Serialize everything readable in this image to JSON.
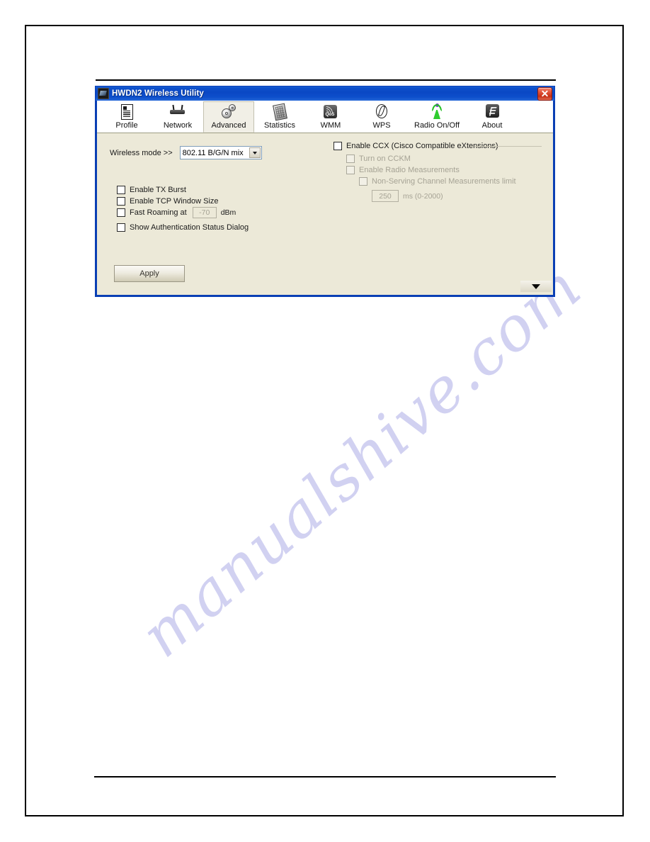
{
  "watermark": {
    "text": "manualshive.com"
  },
  "window": {
    "title": "HWDN2 Wireless Utility",
    "app_icon": "wireless-adapter-icon",
    "close_label": "Close",
    "expand_label": "expand-down-arrow"
  },
  "tabs": [
    {
      "label": "Profile",
      "icon": "profile-document-icon",
      "selected": false
    },
    {
      "label": "Network",
      "icon": "router-icon",
      "selected": false
    },
    {
      "label": "Advanced",
      "icon": "gears-icon",
      "selected": true
    },
    {
      "label": "Statistics",
      "icon": "statistics-grid-icon",
      "selected": false
    },
    {
      "label": "WMM",
      "icon": "qos-signal-icon",
      "selected": false
    },
    {
      "label": "WPS",
      "icon": "wps-circle-icon",
      "selected": false
    },
    {
      "label": "Radio On/Off",
      "icon": "radio-antenna-icon",
      "selected": false
    },
    {
      "label": "About",
      "icon": "about-icon",
      "selected": false
    }
  ],
  "advanced": {
    "wireless_mode_label": "Wireless mode >>",
    "wireless_mode_value": "802.11 B/G/N mix",
    "wireless_mode_options": [
      "802.11 B/G/N mix"
    ],
    "options": [
      {
        "label": "Enable TX Burst",
        "checked": false,
        "enabled": true
      },
      {
        "label": "Enable TCP Window Size",
        "checked": false,
        "enabled": true
      },
      {
        "label": "Fast Roaming at",
        "checked": false,
        "enabled": true
      },
      {
        "label": "Show Authentication Status Dialog",
        "checked": false,
        "enabled": true
      }
    ],
    "fast_roaming_value": "-70",
    "fast_roaming_unit": "dBm",
    "apply_label": "Apply"
  },
  "ccx": {
    "title": "Enable CCX (Cisco Compatible eXtensions)",
    "checked": false,
    "items": [
      {
        "label": "Turn on CCKM",
        "checked": false,
        "enabled": false
      },
      {
        "label": "Enable Radio Measurements",
        "checked": false,
        "enabled": false
      },
      {
        "label": "Non-Serving Channel Measurements limit",
        "checked": false,
        "enabled": false
      }
    ],
    "limit_value": "250",
    "limit_unit": "ms (0-2000)"
  },
  "colors": {
    "titlebar_blue": "#0a47c4",
    "window_border": "#0a3fb4",
    "client_bg": "#ece9d8",
    "close_red": "#c62f16",
    "radio_green": "#2ecc2e",
    "watermark": "#c9c9ef"
  }
}
